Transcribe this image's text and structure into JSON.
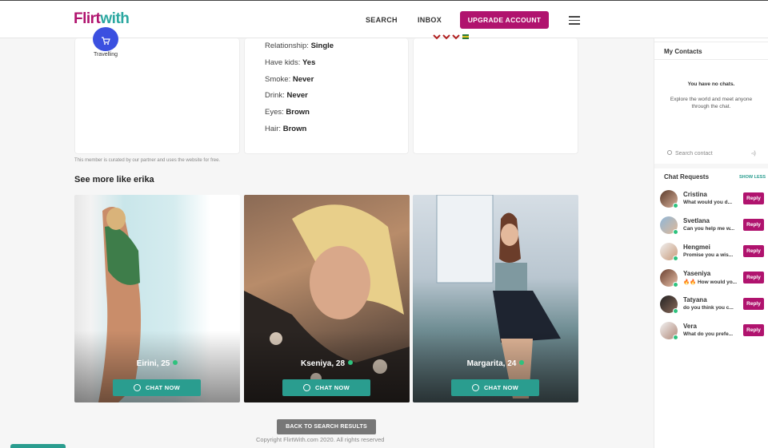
{
  "header": {
    "logo_part1": "Flirt",
    "logo_part2": "with",
    "nav_search": "SEARCH",
    "nav_inbox": "INBOX",
    "upgrade": "UPGRADE ACCOUNT"
  },
  "interests": {
    "icon": "cart-icon",
    "label": "Travelling"
  },
  "details": [
    {
      "label": "Relationship:",
      "value": "Single"
    },
    {
      "label": "Have kids:",
      "value": "Yes"
    },
    {
      "label": "Smoke:",
      "value": "Never"
    },
    {
      "label": "Drink:",
      "value": "Never"
    },
    {
      "label": "Eyes:",
      "value": "Brown"
    },
    {
      "label": "Hair:",
      "value": "Brown"
    }
  ],
  "curated_note": "This member is curated by our partner and uses the website for free.",
  "see_more_title": "See more like erika",
  "profiles": [
    {
      "name": "Eirini, 25",
      "cta": "CHAT NOW"
    },
    {
      "name": "Kseniya, 28",
      "cta": "CHAT NOW"
    },
    {
      "name": "Margarita, 24",
      "cta": "CHAT NOW"
    }
  ],
  "back_button": "BACK TO SEARCH RESULTS",
  "copyright": "Copyright FlirtWith.com 2020. All rights reserved",
  "sidebar": {
    "contacts_title": "My Contacts",
    "no_chats": "You have no chats.",
    "explore": "Explore the world and meet anyone through the chat.",
    "search_placeholder": "Search contact",
    "requests_title": "Chat Requests",
    "show_less": "SHOW LESS",
    "reply_label": "Reply",
    "requests": [
      {
        "name": "Cristina",
        "message": "What would you d..."
      },
      {
        "name": "Svetlana",
        "message": "Can you help me w..."
      },
      {
        "name": "Hengmei",
        "message": "Promise you a wis..."
      },
      {
        "name": "Yaseniya",
        "message": "🔥🔥 How would yo..."
      },
      {
        "name": "Tatyana",
        "message": "do you think you c..."
      },
      {
        "name": "Vera",
        "message": "What do you prefe..."
      }
    ]
  }
}
